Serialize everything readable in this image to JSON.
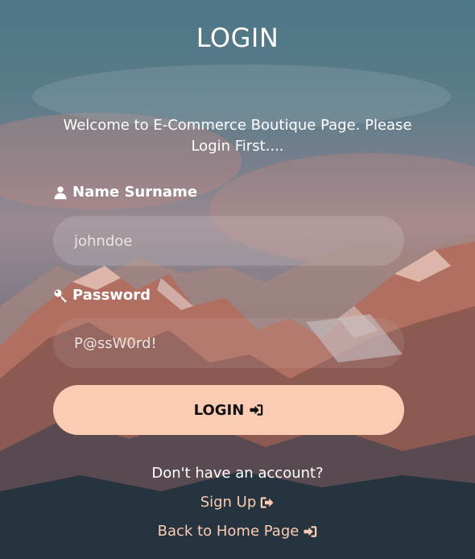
{
  "page": {
    "title": "LOGIN",
    "welcome": "Welcome to E-Commerce Boutique Page. Please Login First...."
  },
  "form": {
    "name_label": "Name Surname",
    "name_placeholder": "johndoe",
    "name_icon": "user-icon",
    "password_label": "Password",
    "password_placeholder": "P@ssW0rd!",
    "password_icon": "key-icon",
    "login_button": "LOGIN",
    "login_icon": "sign-in-icon"
  },
  "footer": {
    "no_account": "Don't have an account?",
    "signup_link": "Sign Up",
    "signup_icon": "sign-out-icon",
    "home_link": "Back to Home Page",
    "home_icon": "sign-in-icon"
  },
  "colors": {
    "accent": "#fbcbb3",
    "button_text": "#111111"
  }
}
